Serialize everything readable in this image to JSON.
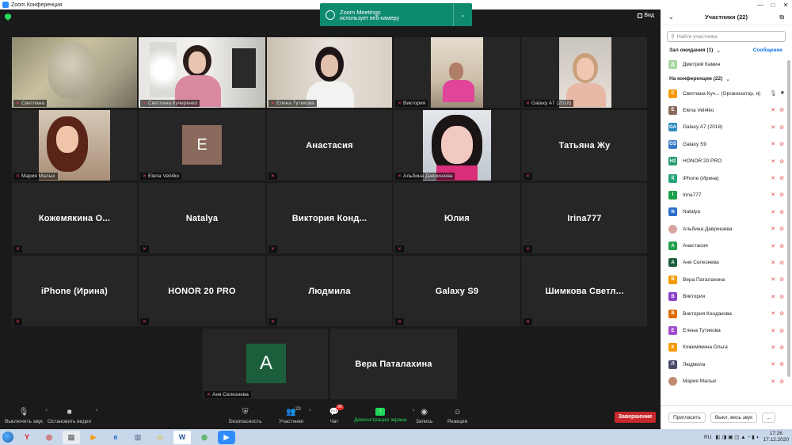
{
  "window": {
    "title": "Zoom Конференция",
    "controls": [
      "—",
      "□",
      "✕"
    ]
  },
  "notice": {
    "title": "Zoom Meetings",
    "text": "использует веб-камеру",
    "chevron": "⌄"
  },
  "view_label": "Вид",
  "tiles": [
    {
      "label": "Светлана",
      "display": ""
    },
    {
      "label": "Светлана Кучеренко",
      "display": ""
    },
    {
      "label": "Елена Тутикова",
      "display": ""
    },
    {
      "label": "Виктория",
      "display": ""
    },
    {
      "label": "Galaxy A7 (2018)",
      "display": ""
    },
    {
      "label": "Мария Малых",
      "display": ""
    },
    {
      "label": "Elena Veli4ko",
      "display": "",
      "avatar_letter": "E"
    },
    {
      "label": "",
      "display": "Анастасия"
    },
    {
      "label": "Альбина Давришева",
      "display": ""
    },
    {
      "label": "",
      "display": "Татьяна Жу"
    },
    {
      "label": "",
      "display": "Кожемякина О..."
    },
    {
      "label": "",
      "display": "Natalya"
    },
    {
      "label": "",
      "display": "Виктория Конд..."
    },
    {
      "label": "",
      "display": "Юлия"
    },
    {
      "label": "",
      "display": "Irina777"
    },
    {
      "label": "",
      "display": "iPhone (Ирина)"
    },
    {
      "label": "",
      "display": "HONOR 20 PRO"
    },
    {
      "label": "",
      "display": "Людмила"
    },
    {
      "label": "",
      "display": "Galaxy S9"
    },
    {
      "label": "",
      "display": "Шимкова Светл..."
    },
    {
      "label": "Аня Селезнева",
      "display": "",
      "avatar_letter": "A"
    },
    {
      "label": "",
      "display": "Вера Паталахина"
    }
  ],
  "toolbar": {
    "mute": "Выключить звук",
    "video": "Остановить видео",
    "security": "Безопасность",
    "participants": "Участники",
    "participants_count": "23",
    "chat": "Чат",
    "chat_badge": "36",
    "share": "Демонстрация экрана",
    "record": "Запись",
    "reactions": "Реакции",
    "end": "Завершение"
  },
  "panel": {
    "title": "Участники (22)",
    "search_placeholder": "Найти участника",
    "waiting_title": "Зал ожидания (1)",
    "waiting_link": "Сообщение",
    "waiting": [
      {
        "initial": "Д",
        "color": "#a8d5a2",
        "name": "Дмитрий Камин"
      }
    ],
    "in_meeting_title": "На конференции (22)",
    "participants": [
      {
        "initial": "С",
        "color": "#f59b00",
        "name": "Светлана Куч... (Организатор, я)",
        "host": true
      },
      {
        "initial": "E",
        "color": "#8a6a5c",
        "name": "Elena Veli4ko"
      },
      {
        "initial": "GA",
        "color": "#2b8cbe",
        "name": "Galaxy A7 (2018)"
      },
      {
        "initial": "GS",
        "color": "#3a7bc8",
        "name": "Galaxy S9"
      },
      {
        "initial": "H2",
        "color": "#2a9d6e",
        "name": "HONOR 20 PRO"
      },
      {
        "initial": "I(",
        "color": "#27a37a",
        "name": "iPhone (Ирина)"
      },
      {
        "initial": "I",
        "color": "#1aa04b",
        "name": "Irina777"
      },
      {
        "initial": "N",
        "color": "#2b6cc8",
        "name": "Natalya"
      },
      {
        "initial": "",
        "color": "#d7a6a0",
        "name": "Альбина Давришева",
        "photo": true
      },
      {
        "initial": "А",
        "color": "#21a04a",
        "name": "Анастасия"
      },
      {
        "initial": "А",
        "color": "#1b5e3c",
        "name": "Аня Селезнева"
      },
      {
        "initial": "В",
        "color": "#f59b00",
        "name": "Вера Паталахина"
      },
      {
        "initial": "В",
        "color": "#8a3fc8",
        "name": "Виктория"
      },
      {
        "initial": "В",
        "color": "#e06a00",
        "name": "Виктория Кондакова"
      },
      {
        "initial": "Е",
        "color": "#a04ad0",
        "name": "Елена Тутикова"
      },
      {
        "initial": "К",
        "color": "#f59b00",
        "name": "Кожемякина Ольга"
      },
      {
        "initial": "Л",
        "color": "#4a4a6a",
        "name": "Людмила"
      },
      {
        "initial": "",
        "color": "#c08a70",
        "name": "Мария Малых",
        "photo": true
      }
    ],
    "footer_invite": "Пригласить",
    "footer_mute_all": "Выкл. весь звук",
    "footer_more": "..."
  },
  "taskbar": {
    "lang": "RU",
    "time": "17:26",
    "date": "17.12.2020"
  }
}
